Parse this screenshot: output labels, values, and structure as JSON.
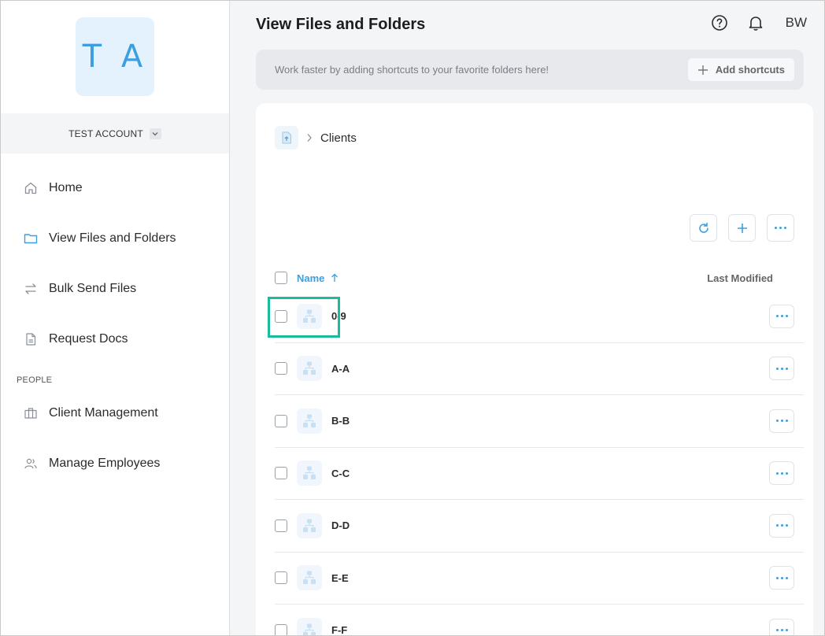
{
  "sidebar": {
    "avatar_initials": "T A",
    "account_name": "TEST ACCOUNT",
    "items": [
      {
        "label": "Home",
        "icon": "home-icon"
      },
      {
        "label": "View Files and Folders",
        "icon": "folder-icon",
        "active": true
      },
      {
        "label": "Bulk Send Files",
        "icon": "transfer-icon"
      },
      {
        "label": "Request Docs",
        "icon": "document-icon"
      }
    ],
    "section_people": "PEOPLE",
    "people_items": [
      {
        "label": "Client Management",
        "icon": "briefcase-icon"
      },
      {
        "label": "Manage Employees",
        "icon": "users-icon"
      }
    ]
  },
  "header": {
    "title": "View Files and Folders",
    "user_initials": "BW"
  },
  "shortcuts": {
    "message": "Work faster by adding shortcuts to your favorite folders here!",
    "add_label": "Add shortcuts"
  },
  "breadcrumb": {
    "current": "Clients"
  },
  "table": {
    "col_name": "Name",
    "col_modified": "Last Modified",
    "rows": [
      "0-9",
      "A-A",
      "B-B",
      "C-C",
      "D-D",
      "E-E",
      "F-F"
    ]
  },
  "colors": {
    "accent": "#3d9fe0",
    "highlight": "#1abc9c",
    "background": "#f4f5f7"
  }
}
